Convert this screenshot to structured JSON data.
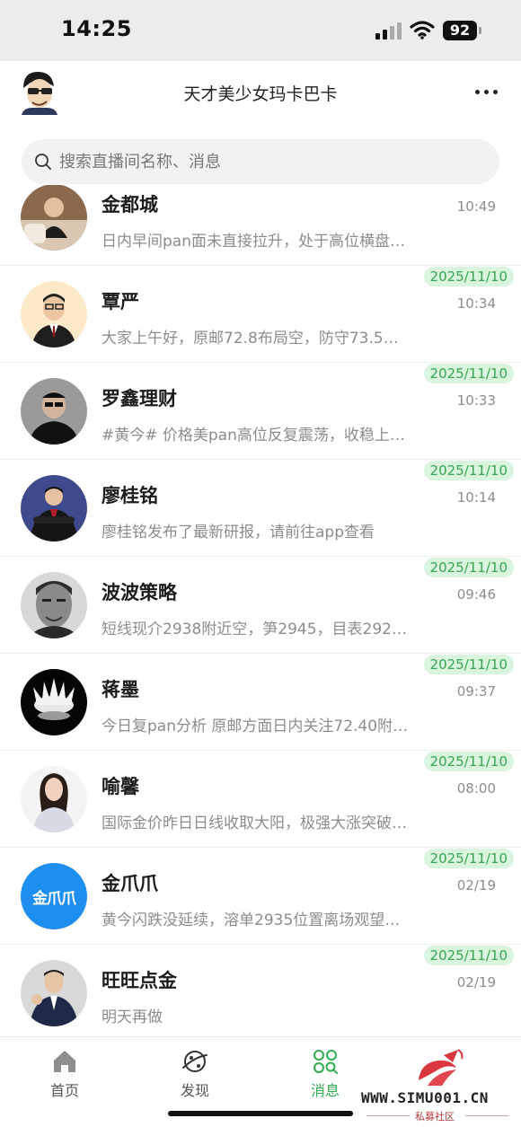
{
  "status_bar": {
    "time": "14:25",
    "battery": "92"
  },
  "header": {
    "title": "天才美少女玛卡巴卡",
    "more_icon": "more-dots-icon"
  },
  "search": {
    "placeholder": "搜索直播间名称、消息"
  },
  "chats": [
    {
      "name": "金都城",
      "preview": "日内早间pan面未直接拉升，处于高位横盘…",
      "date": "",
      "time": "10:49"
    },
    {
      "name": "覃严",
      "preview": "大家上午好，原邮72.8布局空，防守73.5…",
      "date": "2025/11/10",
      "time": "10:34"
    },
    {
      "name": "罗鑫理财",
      "preview": "#黄今# 价格美pan高位反复震荡，收稳上方…",
      "date": "2025/11/10",
      "time": "10:33"
    },
    {
      "name": "廖桂铭",
      "preview": "廖桂铭发布了最新研报，请前往app查看",
      "date": "2025/11/10",
      "time": "10:14"
    },
    {
      "name": "波波策略",
      "preview": "短线现介2938附近空，笋2945，目表2920…",
      "date": "2025/11/10",
      "time": "09:46"
    },
    {
      "name": "蒋墨",
      "preview": "今日复pan分析 原邮方面日内关注72.40附近…",
      "date": "2025/11/10",
      "time": "09:37"
    },
    {
      "name": "喻馨",
      "preview": "国际金价昨日日线收取大阳，极强大涨突破…",
      "date": "2025/11/10",
      "time": "08:00"
    },
    {
      "name": "金爪爪",
      "preview": "黄今闪跌没延续，溶单2935位置离场观望…",
      "date": "2025/11/10",
      "time": "02/19",
      "avatar_text": "金爪爪"
    },
    {
      "name": "旺旺点金",
      "preview": "明天再做",
      "date": "2025/11/10",
      "time": "02/19"
    }
  ],
  "nav": [
    {
      "label": "首页",
      "icon": "home-icon",
      "active": false
    },
    {
      "label": "发现",
      "icon": "discover-planet-icon",
      "active": false
    },
    {
      "label": "消息",
      "icon": "messages-icon",
      "active": true
    }
  ],
  "watermark": {
    "text": "WWW.SIMU001.CN",
    "sub": "私募社区"
  },
  "colors": {
    "accent_green": "#2eae4f",
    "date_badge_bg": "#d9f5dd",
    "date_badge_text": "#3aa453",
    "search_bg": "#f2f2f2"
  }
}
